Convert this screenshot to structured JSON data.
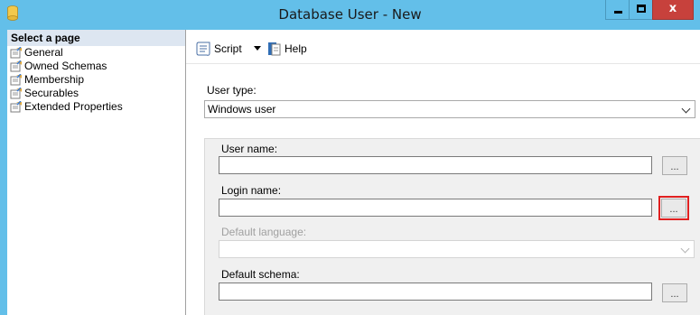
{
  "window": {
    "title": "Database User - New",
    "controls": {
      "minimize": "minimize",
      "maximize": "maximize",
      "close": "x"
    },
    "accent": "#63bfe9",
    "close_color": "#c7413c"
  },
  "sidebar": {
    "header": "Select a page",
    "items": [
      {
        "label": "General",
        "icon": "page-icon"
      },
      {
        "label": "Owned Schemas",
        "icon": "page-icon"
      },
      {
        "label": "Membership",
        "icon": "page-icon"
      },
      {
        "label": "Securables",
        "icon": "page-icon"
      },
      {
        "label": "Extended Properties",
        "icon": "page-icon"
      }
    ]
  },
  "toolbar": {
    "script_label": "Script",
    "help_label": "Help"
  },
  "form": {
    "user_type": {
      "label": "User type:",
      "value": "Windows user"
    },
    "user_name": {
      "label": "User name:",
      "value": "",
      "browse": "..."
    },
    "login_name": {
      "label": "Login name:",
      "value": "",
      "browse": "..."
    },
    "default_language": {
      "label": "Default language:",
      "value": ""
    },
    "default_schema": {
      "label": "Default schema:",
      "value": "",
      "browse": "..."
    }
  }
}
